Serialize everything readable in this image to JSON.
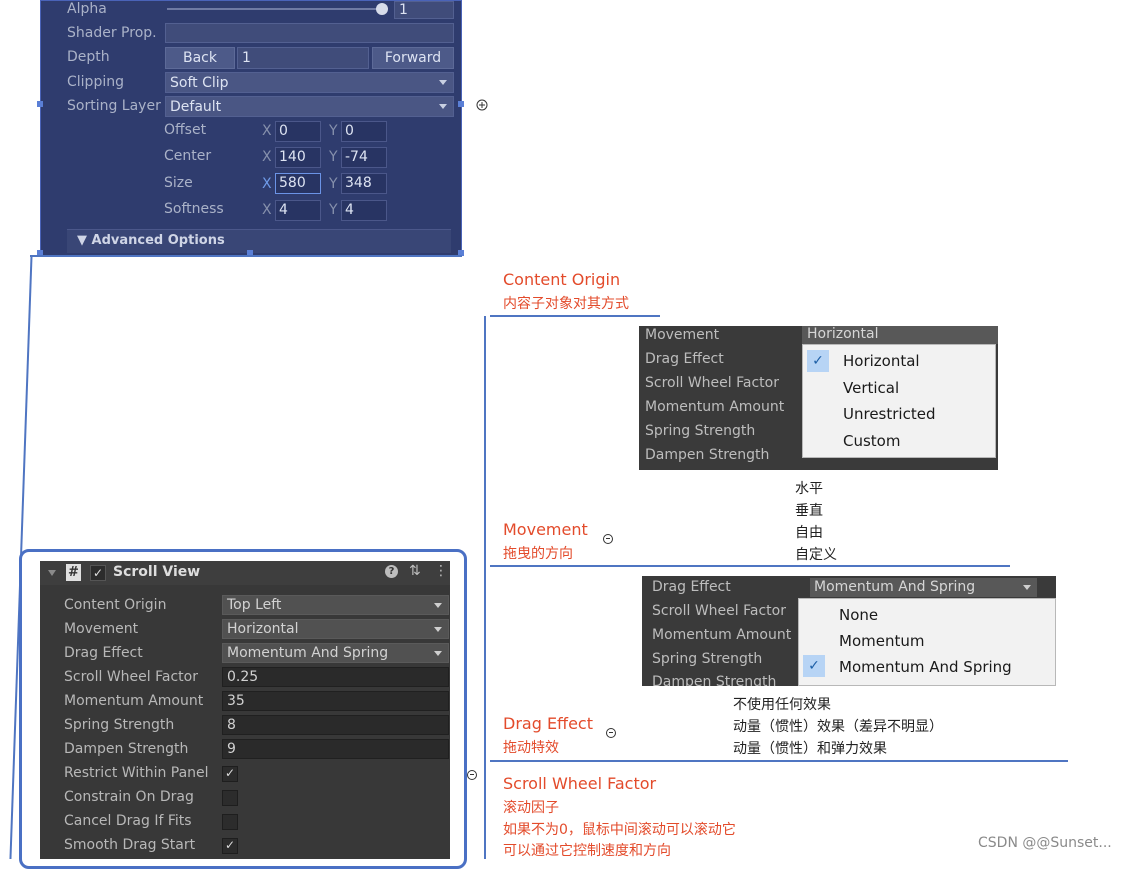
{
  "top_panel": {
    "alpha_label": "Alpha",
    "alpha_value": "1",
    "alpha_fraction": 1.0,
    "shader_label": "Shader Prop.",
    "depth_label": "Depth",
    "back_button": "Back",
    "depth_value": "1",
    "forward_button": "Forward",
    "clipping_label": "Clipping",
    "clipping_value": "Soft Clip",
    "sorting_label": "Sorting Layer",
    "sorting_value": "Default",
    "rows": [
      {
        "label": "Offset",
        "x": "0",
        "y": "0"
      },
      {
        "label": "Center",
        "x": "140",
        "y": "-74"
      },
      {
        "label": "Size",
        "x": "580",
        "y": "348"
      },
      {
        "label": "Softness",
        "x": "4",
        "y": "4"
      }
    ],
    "x_letter": "X",
    "y_letter": "Y",
    "advanced": "▼ Advanced Options"
  },
  "scroll_view": {
    "title": "Scroll View",
    "hash_icon": "#",
    "checkbox_mark": "✓",
    "help_icon": "?",
    "settings_icon": "⇅",
    "menu_icon": "⋮",
    "fields": [
      {
        "label": "Content Origin",
        "value": "Top Left",
        "kind": "dropdown"
      },
      {
        "label": "Movement",
        "value": "Horizontal",
        "kind": "dropdown"
      },
      {
        "label": "Drag Effect",
        "value": "Momentum And Spring",
        "kind": "dropdown"
      },
      {
        "label": "Scroll Wheel Factor",
        "value": "0.25",
        "kind": "text"
      },
      {
        "label": "Momentum Amount",
        "value": "35",
        "kind": "text"
      },
      {
        "label": "Spring Strength",
        "value": "8",
        "kind": "text"
      },
      {
        "label": "Dampen Strength",
        "value": "9",
        "kind": "text"
      }
    ],
    "checks": [
      {
        "label": "Restrict Within Panel",
        "checked": true,
        "mark": "✓"
      },
      {
        "label": "Constrain On Drag",
        "checked": false,
        "mark": ""
      },
      {
        "label": "Cancel Drag If Fits",
        "checked": false,
        "mark": ""
      },
      {
        "label": "Smooth Drag Start",
        "checked": true,
        "mark": "✓"
      }
    ]
  },
  "annotations": {
    "content_origin_en": "Content Origin",
    "content_origin_zh": "内容子对象对其方式",
    "movement_en": "Movement",
    "movement_zh": "拖曳的方向",
    "movement_notes": [
      "水平",
      "垂直",
      "自由",
      "自定义"
    ],
    "drag_effect_en": "Drag Effect",
    "drag_effect_zh": "拖动特效",
    "drag_notes": [
      "不使用任何效果",
      "动量（惯性）效果（差异不明显）",
      "动量（惯性）和弹力效果"
    ],
    "scroll_wheel_en": "Scroll Wheel Factor",
    "scroll_wheel_zh": "滚动因子",
    "scroll_wheel_note1": "如果不为0，鼠标中间滚动可以滚动它",
    "scroll_wheel_note2": "可以通过它控制速度和方向"
  },
  "movement_shot": {
    "labels": [
      "Movement",
      "Drag Effect",
      "Scroll Wheel Factor",
      "Momentum Amount",
      "Spring Strength",
      "Dampen Strength"
    ],
    "current": "Horizontal",
    "options": [
      "Horizontal",
      "Vertical",
      "Unrestricted",
      "Custom"
    ],
    "selected_index": 0,
    "tick": "✓"
  },
  "drag_shot": {
    "labels": [
      "Drag Effect",
      "Scroll Wheel Factor",
      "Momentum Amount",
      "Spring Strength",
      "Dampen Strength"
    ],
    "current": "Momentum And Spring",
    "options": [
      "None",
      "Momentum",
      "Momentum And Spring"
    ],
    "selected_index": 2,
    "tick": "✓"
  },
  "watermark": "CSDN @@Sunset...",
  "colors": {
    "annotation_red": "#e34b2b",
    "connector_blue": "#4f75c2",
    "panel_blue": "#2f3c6e",
    "unity_dark": "#383838"
  }
}
